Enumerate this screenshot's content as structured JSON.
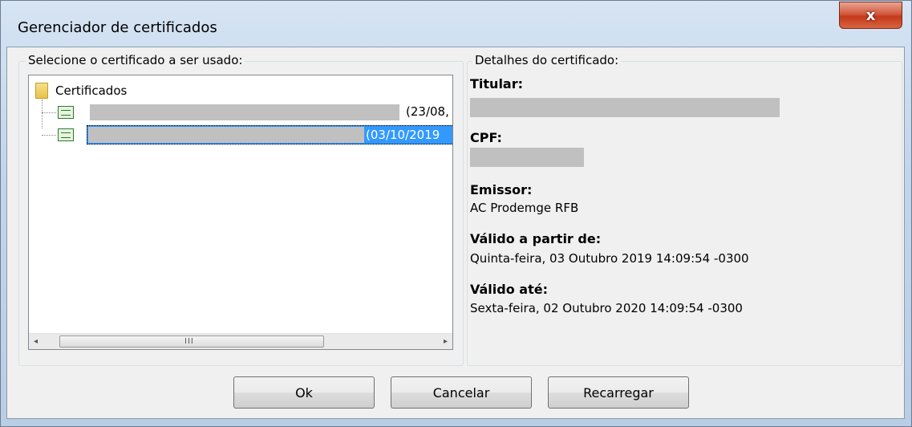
{
  "window": {
    "title": "Gerenciador de certificados",
    "close_glyph": "x"
  },
  "left_group": {
    "legend": "Selecione o certificado a ser usado:",
    "tree": {
      "root_label": "Certificados",
      "items": [
        {
          "date_text": "(23/08,",
          "selected": false
        },
        {
          "date_text": "(03/10/2019",
          "selected": true
        }
      ]
    },
    "scrollbar": {
      "left_arrow": "◂",
      "right_arrow": "▸",
      "grip": "III"
    }
  },
  "right_group": {
    "legend": "Detalhes do certificado:",
    "fields": {
      "titular_label": "Titular:",
      "cpf_label": "CPF:",
      "emissor_label": "Emissor:",
      "emissor_value": "AC Prodemge RFB",
      "valid_from_label": "Válido a partir de:",
      "valid_from_value": "Quinta-feira, 03 Outubro 2019 14:09:54 -0300",
      "valid_until_label": "Válido até:",
      "valid_until_value": "Sexta-feira, 02 Outubro 2020 14:09:54 -0300"
    }
  },
  "buttons": {
    "ok": "Ok",
    "cancel": "Cancelar",
    "reload": "Recarregar"
  },
  "colors": {
    "selection": "#3399ff",
    "close_button": "#c23a1c"
  }
}
